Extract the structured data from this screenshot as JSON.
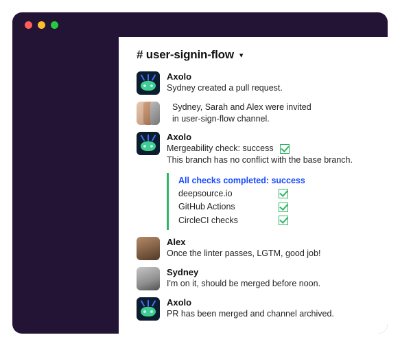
{
  "channel": {
    "name": "# user-signin-flow"
  },
  "messages": [
    {
      "author": "Axolo",
      "lines": [
        "Sydney created a pull request."
      ]
    },
    {
      "author": "",
      "lines": [
        "Sydney, Sarah and Alex were invited",
        "in user-sign-flow channel."
      ]
    },
    {
      "author": "Axolo",
      "lines": [
        "Mergeability check: success",
        "This branch has no conflict with the base branch."
      ]
    }
  ],
  "thread": {
    "title": "All checks completed: success",
    "rows": [
      {
        "label": "deepsource.io"
      },
      {
        "label": "GitHub Actions"
      },
      {
        "label": "CircleCI checks"
      }
    ]
  },
  "replies": [
    {
      "author": "Alex",
      "lines": [
        "Once the linter passes, LGTM, good job!"
      ]
    },
    {
      "author": "Sydney",
      "lines": [
        "I'm on it, should be merged before noon."
      ]
    },
    {
      "author": "Axolo",
      "lines": [
        "PR has been merged and channel archived."
      ]
    }
  ]
}
